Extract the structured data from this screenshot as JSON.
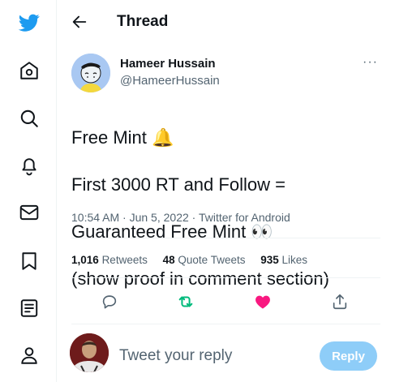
{
  "header": {
    "title": "Thread"
  },
  "tweet": {
    "author_name": "Hameer Hussain",
    "author_handle": "@HameerHussain",
    "more_label": "···",
    "text_lines": [
      "Free Mint 🔔",
      "First 3000 RT and Follow  =",
      "Guaranteed Free Mint 👀",
      "(show proof in comment section)"
    ],
    "meta": "10:54 AM · Jun 5, 2022 · Twitter for Android"
  },
  "stats": {
    "retweets_count": "1,016",
    "retweets_label": "Retweets",
    "quotes_count": "48",
    "quotes_label": "Quote Tweets",
    "likes_count": "935",
    "likes_label": "Likes"
  },
  "composer": {
    "placeholder": "Tweet your reply",
    "reply_label": "Reply"
  },
  "colors": {
    "brand": "#1d9bf0",
    "retweet_active": "#00ba7c",
    "like_active": "#f91880",
    "reply_button_disabled": "#8ecdf8",
    "secondary_text": "#536471"
  },
  "icons": {
    "sidebar": [
      "twitter-logo-icon",
      "home-icon",
      "search-icon",
      "notifications-bell-icon",
      "messages-envelope-icon",
      "bookmark-icon",
      "lists-icon",
      "profile-icon"
    ],
    "actions": [
      "reply-icon",
      "retweet-icon",
      "like-heart-icon",
      "share-icon"
    ]
  }
}
